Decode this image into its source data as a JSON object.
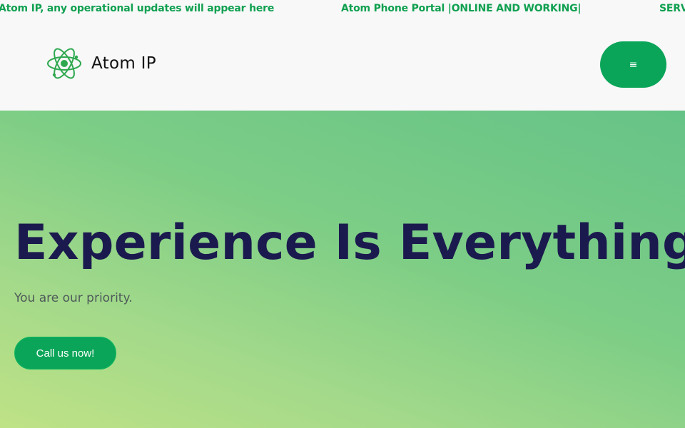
{
  "ticker": {
    "items": [
      "Atom IP, any operational updates will appear here",
      "Atom Phone Portal |ONLINE AND WORKING|",
      "SERV"
    ]
  },
  "header": {
    "brand_name": "Atom IP",
    "logo_icon": "atom-icon",
    "menu_icon": "hamburger-menu-icon",
    "menu_glyph": "≡"
  },
  "hero": {
    "title": "Experience Is Everything.",
    "subtitle": "You are our priority.",
    "cta_label": "Call us now!"
  },
  "colors": {
    "accent_green": "#0aa558",
    "ticker_text": "#10a050",
    "title_navy": "#1b1a4e",
    "hero_gradient_start": "#bfe286",
    "hero_gradient_end": "#66c387"
  }
}
